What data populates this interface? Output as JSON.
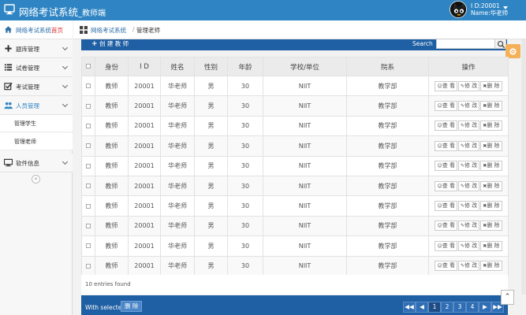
{
  "header": {
    "title": "网络考试系统",
    "subtitle": "_教师端",
    "user_id": "I D:20001",
    "user_name": "Name:华老师"
  },
  "sidebar": {
    "home_label": "网络考试系统",
    "home_suffix": "首页",
    "items": [
      {
        "label": "题库管理"
      },
      {
        "label": "试卷管理"
      },
      {
        "label": "考试管理"
      },
      {
        "label": "人员管理"
      },
      {
        "label": "软件信息"
      }
    ],
    "subitems": [
      {
        "label": "管理学生"
      },
      {
        "label": "管理老师"
      }
    ],
    "collapse_glyph": "«"
  },
  "breadcrumb": {
    "home": "网络考试系统",
    "sep": "/",
    "current": "管理老师"
  },
  "toolbar": {
    "create_label": "创 建 教 师",
    "search_label": "Search",
    "search_value": ""
  },
  "table": {
    "headers": [
      "",
      "身份",
      "I D",
      "姓名",
      "性别",
      "年龄",
      "学校/单位",
      "院系",
      "操作"
    ],
    "actions": [
      "查 看",
      "修 改",
      "删 除"
    ],
    "rows": [
      [
        "教师",
        "20001",
        "华老师",
        "男",
        "30",
        "NIIT",
        "教学部"
      ],
      [
        "教师",
        "20001",
        "华老师",
        "男",
        "30",
        "NIIT",
        "教学部"
      ],
      [
        "教师",
        "20001",
        "华老师",
        "男",
        "30",
        "NIIT",
        "教学部"
      ],
      [
        "教师",
        "20001",
        "华老师",
        "男",
        "30",
        "NIIT",
        "教学部"
      ],
      [
        "教师",
        "20001",
        "华老师",
        "男",
        "30",
        "NIIT",
        "教学部"
      ],
      [
        "教师",
        "20001",
        "华老师",
        "男",
        "30",
        "NIIT",
        "教学部"
      ],
      [
        "教师",
        "20001",
        "华老师",
        "男",
        "30",
        "NIIT",
        "教学部"
      ],
      [
        "教师",
        "20001",
        "华老师",
        "男",
        "30",
        "NIIT",
        "教学部"
      ],
      [
        "教师",
        "20001",
        "华老师",
        "男",
        "30",
        "NIIT",
        "教学部"
      ],
      [
        "教师",
        "20001",
        "华老师",
        "男",
        "30",
        "NIIT",
        "教学部"
      ]
    ]
  },
  "footer": {
    "entries": "10 entries found",
    "with_selected": "With selected:",
    "delete_label": "删 除",
    "pages": [
      "1",
      "2",
      "3",
      "4"
    ],
    "current_page": "1"
  },
  "colors": {
    "topbar": "#2f85c3",
    "panel": "#1f5fa3",
    "accent": "#f5b05a"
  }
}
